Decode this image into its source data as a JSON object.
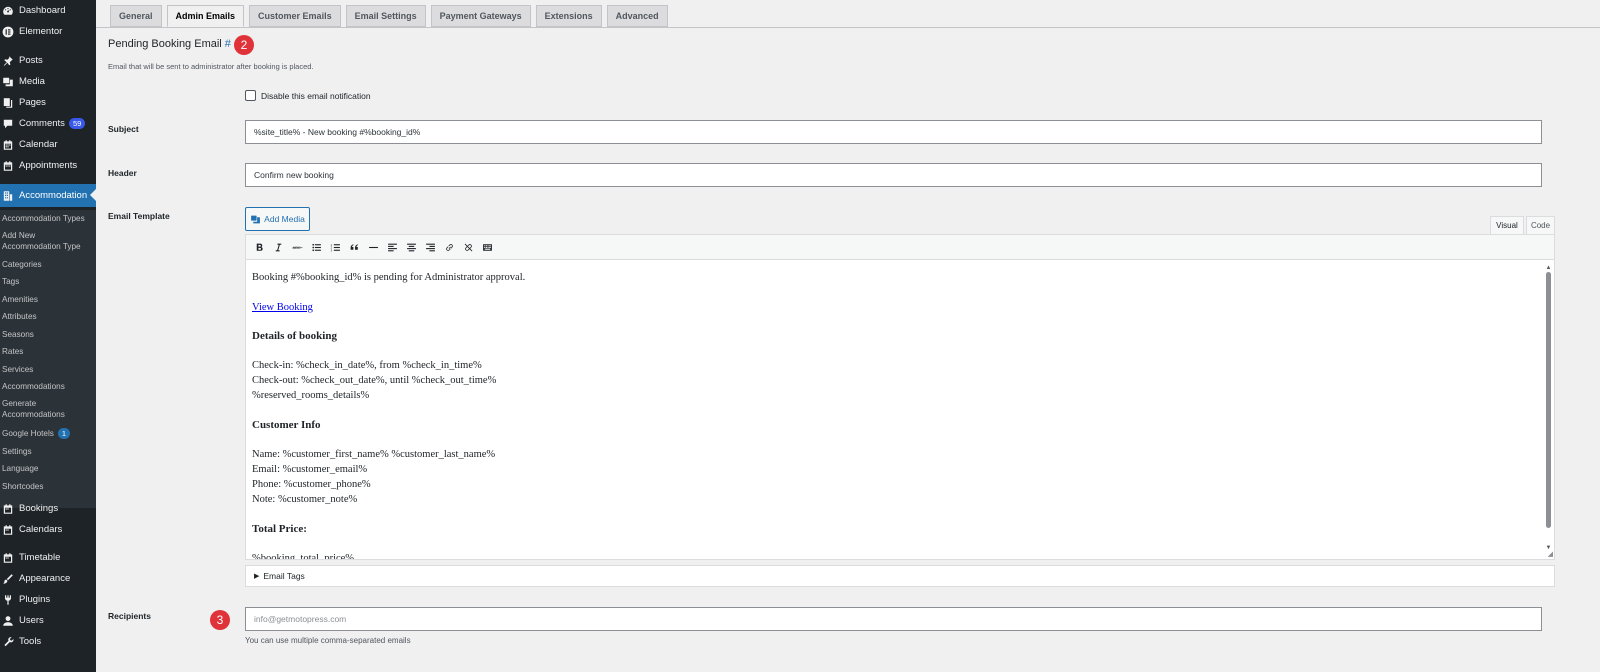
{
  "sidebar": {
    "top_items": [
      {
        "label": "Dashboard",
        "icon": "dashboard-icon"
      },
      {
        "label": "Elementor",
        "icon": "elementor-icon"
      },
      {
        "label": "Posts",
        "icon": "pin-icon"
      },
      {
        "label": "Media",
        "icon": "media-icon"
      },
      {
        "label": "Pages",
        "icon": "pages-icon"
      },
      {
        "label": "Comments",
        "icon": "comment-icon",
        "badge": "59"
      },
      {
        "label": "Calendar",
        "icon": "calendar-icon"
      },
      {
        "label": "Appointments",
        "icon": "calendar-icon"
      },
      {
        "label": "Accommodation",
        "icon": "building-icon"
      }
    ],
    "submenu": [
      "Accommodation Types",
      "Add New Accommodation Type",
      "Categories",
      "Tags",
      "Amenities",
      "Attributes",
      "Seasons",
      "Rates",
      "Services",
      "Accommodations",
      "Generate Accommodations",
      "Google Hotels",
      "Settings",
      "Language",
      "Shortcodes"
    ],
    "google_hotels_badge": "1",
    "bottom_items": [
      {
        "label": "Bookings",
        "icon": "calendar-icon"
      },
      {
        "label": "Calendars",
        "icon": "calendar-icon"
      },
      {
        "label": "Timetable",
        "icon": "calendar-icon"
      },
      {
        "label": "Appearance",
        "icon": "brush-icon"
      },
      {
        "label": "Plugins",
        "icon": "plugin-icon"
      },
      {
        "label": "Users",
        "icon": "user-icon"
      },
      {
        "label": "Tools",
        "icon": "wrench-icon"
      }
    ]
  },
  "tabs": [
    "General",
    "Admin Emails",
    "Customer Emails",
    "Email Settings",
    "Payment Gateways",
    "Extensions",
    "Advanced"
  ],
  "active_tab": "Admin Emails",
  "section": {
    "title": "Pending Booking Email",
    "anchor": "#",
    "description": "Email that will be sent to administrator after booking is placed.",
    "callout_2": "2",
    "callout_3": "3"
  },
  "form": {
    "disable_label": "Disable this email notification",
    "subject_label": "Subject",
    "subject_value": "%site_title% - New booking #%booking_id%",
    "header_label": "Header",
    "header_value": "Confirm new booking",
    "template_label": "Email Template",
    "add_media_label": "Add Media",
    "visual_tab": "Visual",
    "code_tab": "Code",
    "email_tags_label": "Email Tags",
    "recipients_label": "Recipients",
    "recipients_placeholder": "info@getmotopress.com",
    "recipients_help": "You can use multiple comma-separated emails"
  },
  "editor": {
    "line1": "Booking #%booking_id% is pending for Administrator approval.",
    "link": "View Booking",
    "details_heading": "Details of booking",
    "checkin": "Check-in: %check_in_date%, from %check_in_time%",
    "checkout": "Check-out: %check_out_date%, until %check_out_time%",
    "reserved": "%reserved_rooms_details%",
    "customer_heading": "Customer Info",
    "name": "Name: %customer_first_name% %customer_last_name%",
    "email": "Email: %customer_email%",
    "phone": "Phone: %customer_phone%",
    "note": "Note: %customer_note%",
    "price_heading": "Total Price:",
    "price_value": "%booking_total_price%"
  },
  "toolbar_buttons": [
    "bold",
    "italic",
    "strikethrough",
    "bullet-list",
    "numbered-list",
    "blockquote",
    "horizontal-line",
    "align-left",
    "align-center",
    "align-right",
    "insert-link",
    "remove-link",
    "toolbar-toggle"
  ]
}
